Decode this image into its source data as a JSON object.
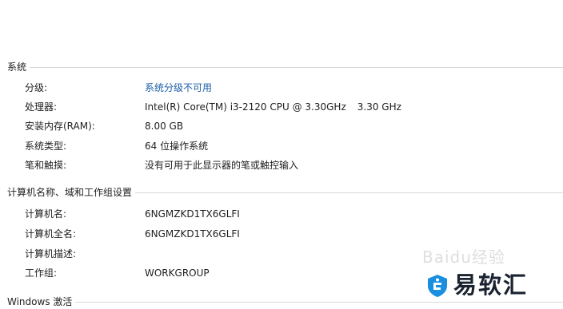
{
  "system": {
    "title": "系统",
    "rows": [
      {
        "label": "分级:",
        "value": "系统分级不可用"
      },
      {
        "label": "处理器:",
        "value": "Intel(R) Core(TM) i3-2120 CPU @ 3.30GHz",
        "extra": "3.30 GHz"
      },
      {
        "label": "安装内存(RAM):",
        "value": "8.00 GB"
      },
      {
        "label": "系统类型:",
        "value": "64 位操作系统"
      },
      {
        "label": "笔和触摸:",
        "value": "没有可用于此显示器的笔或触控输入"
      }
    ]
  },
  "computer": {
    "title": "计算机名称、域和工作组设置",
    "rows": [
      {
        "label": "计算机名:",
        "value": "6NGMZKD1TX6GLFI"
      },
      {
        "label": "计算机全名:",
        "value": "6NGMZKD1TX6GLFI"
      },
      {
        "label": "计算机描述:",
        "value": ""
      },
      {
        "label": "工作组:",
        "value": "WORKGROUP"
      }
    ]
  },
  "activation": {
    "title": "Windows 激活"
  },
  "watermark": {
    "brand": "易软汇",
    "faint": "Baidu经验",
    "brand_color": "#1a8fe0"
  }
}
